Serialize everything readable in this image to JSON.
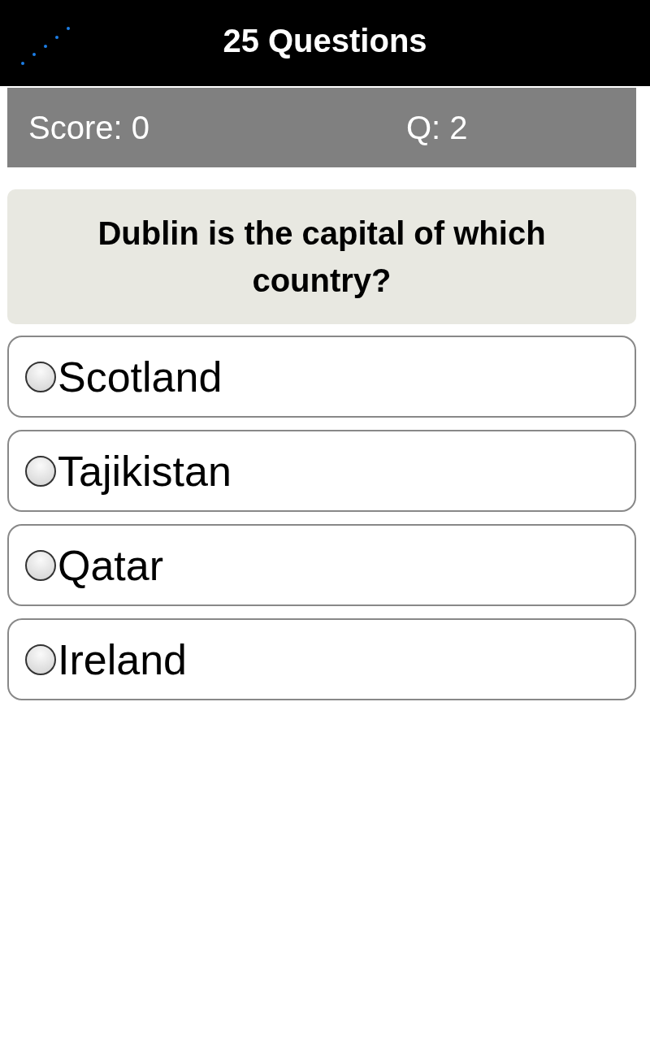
{
  "header": {
    "title": "25 Questions"
  },
  "status": {
    "score": "Score: 0",
    "question_number": "Q: 2"
  },
  "question": "Dublin is the capital of which country?",
  "options": [
    {
      "label": "Scotland",
      "selected": false
    },
    {
      "label": "Tajikistan",
      "selected": false
    },
    {
      "label": "Qatar",
      "selected": false
    },
    {
      "label": "Ireland",
      "selected": false
    }
  ]
}
